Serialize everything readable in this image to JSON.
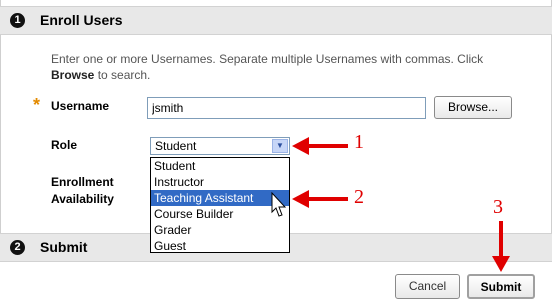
{
  "step1": {
    "number": "1",
    "title": "Enroll Users"
  },
  "instructions": {
    "line1": "Enter one or more Usernames. Separate multiple Usernames with commas. Click",
    "browse_word": "Browse",
    "line2_rest": " to search."
  },
  "fields": {
    "required_marker": "*",
    "username_label": "Username",
    "username_value": "jsmith",
    "browse_label": "Browse...",
    "role_label": "Role",
    "role_selected": "Student",
    "enrollment_label_line1": "Enrollment",
    "enrollment_label_line2": "Availability"
  },
  "role_options": [
    "Student",
    "Instructor",
    "Teaching Assistant",
    "Course Builder",
    "Grader",
    "Guest"
  ],
  "highlighted_option": "Teaching Assistant",
  "step2": {
    "number": "2",
    "title": "Submit"
  },
  "buttons": {
    "cancel": "Cancel",
    "submit": "Submit"
  },
  "annotations": {
    "n1": "1",
    "n2": "2",
    "n3": "3"
  },
  "colors": {
    "annotation": "#e00000",
    "highlight": "#316ac5",
    "required": "#e38a00"
  },
  "icons": {
    "select_arrow": "chevron-down-icon",
    "cursor": "mouse-pointer-icon"
  }
}
